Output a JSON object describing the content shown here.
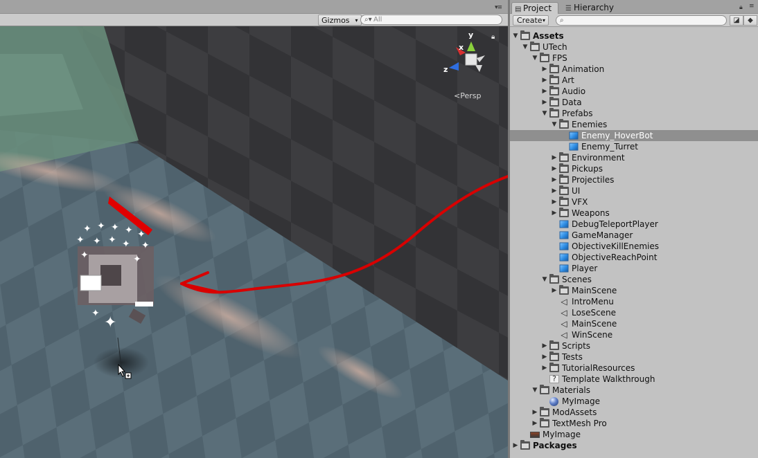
{
  "scene": {
    "gizmos_label": "Gizmos",
    "search_placeholder": "All",
    "search_icon": "search-icon",
    "persp_label": "Persp",
    "axes": {
      "x": "x",
      "y": "y",
      "z": "z"
    },
    "colors": {
      "health_bar": "#e00000",
      "annotation_arrow": "#d80000"
    }
  },
  "project": {
    "tabs": [
      {
        "label": "Project",
        "icon": "folder-icon",
        "active": true
      },
      {
        "label": "Hierarchy",
        "icon": "list-icon",
        "active": false
      }
    ],
    "create_label": "Create",
    "search_placeholder": "",
    "tree": [
      {
        "label": "Assets",
        "depth": 0,
        "arrow": "open",
        "icon": "folder",
        "bold": true
      },
      {
        "label": "UTech",
        "depth": 1,
        "arrow": "open",
        "icon": "folder"
      },
      {
        "label": "FPS",
        "depth": 2,
        "arrow": "open",
        "icon": "folder"
      },
      {
        "label": "Animation",
        "depth": 3,
        "arrow": "closed",
        "icon": "folder"
      },
      {
        "label": "Art",
        "depth": 3,
        "arrow": "closed",
        "icon": "folder"
      },
      {
        "label": "Audio",
        "depth": 3,
        "arrow": "closed",
        "icon": "folder"
      },
      {
        "label": "Data",
        "depth": 3,
        "arrow": "closed",
        "icon": "folder"
      },
      {
        "label": "Prefabs",
        "depth": 3,
        "arrow": "open",
        "icon": "folder"
      },
      {
        "label": "Enemies",
        "depth": 4,
        "arrow": "open",
        "icon": "folder"
      },
      {
        "label": "Enemy_HoverBot",
        "depth": 5,
        "arrow": "none",
        "icon": "prefab",
        "selected": true
      },
      {
        "label": "Enemy_Turret",
        "depth": 5,
        "arrow": "none",
        "icon": "prefab"
      },
      {
        "label": "Environment",
        "depth": 4,
        "arrow": "closed",
        "icon": "folder"
      },
      {
        "label": "Pickups",
        "depth": 4,
        "arrow": "closed",
        "icon": "folder"
      },
      {
        "label": "Projectiles",
        "depth": 4,
        "arrow": "closed",
        "icon": "folder"
      },
      {
        "label": "UI",
        "depth": 4,
        "arrow": "closed",
        "icon": "folder"
      },
      {
        "label": "VFX",
        "depth": 4,
        "arrow": "closed",
        "icon": "folder"
      },
      {
        "label": "Weapons",
        "depth": 4,
        "arrow": "closed",
        "icon": "folder"
      },
      {
        "label": "DebugTeleportPlayer",
        "depth": 4,
        "arrow": "none",
        "icon": "prefab"
      },
      {
        "label": "GameManager",
        "depth": 4,
        "arrow": "none",
        "icon": "prefab"
      },
      {
        "label": "ObjectiveKillEnemies",
        "depth": 4,
        "arrow": "none",
        "icon": "prefab"
      },
      {
        "label": "ObjectiveReachPoint",
        "depth": 4,
        "arrow": "none",
        "icon": "prefab"
      },
      {
        "label": "Player",
        "depth": 4,
        "arrow": "none",
        "icon": "prefab"
      },
      {
        "label": "Scenes",
        "depth": 3,
        "arrow": "open",
        "icon": "folder"
      },
      {
        "label": "MainScene",
        "depth": 4,
        "arrow": "closed",
        "icon": "folder"
      },
      {
        "label": "IntroMenu",
        "depth": 4,
        "arrow": "none",
        "icon": "scene"
      },
      {
        "label": "LoseScene",
        "depth": 4,
        "arrow": "none",
        "icon": "scene"
      },
      {
        "label": "MainScene",
        "depth": 4,
        "arrow": "none",
        "icon": "scene"
      },
      {
        "label": "WinScene",
        "depth": 4,
        "arrow": "none",
        "icon": "scene"
      },
      {
        "label": "Scripts",
        "depth": 3,
        "arrow": "closed",
        "icon": "folder"
      },
      {
        "label": "Tests",
        "depth": 3,
        "arrow": "closed",
        "icon": "folder"
      },
      {
        "label": "TutorialResources",
        "depth": 3,
        "arrow": "closed",
        "icon": "folder"
      },
      {
        "label": "Template Walkthrough",
        "depth": 3,
        "arrow": "none",
        "icon": "question"
      },
      {
        "label": "Materials",
        "depth": 2,
        "arrow": "open",
        "icon": "folder"
      },
      {
        "label": "MyImage",
        "depth": 3,
        "arrow": "none",
        "icon": "material"
      },
      {
        "label": "ModAssets",
        "depth": 2,
        "arrow": "closed",
        "icon": "folder"
      },
      {
        "label": "TextMesh Pro",
        "depth": 2,
        "arrow": "closed",
        "icon": "folder"
      },
      {
        "label": "MyImage",
        "depth": 1,
        "arrow": "none",
        "icon": "image"
      },
      {
        "label": "Packages",
        "depth": 0,
        "arrow": "closed",
        "icon": "folder",
        "bold": true
      }
    ]
  }
}
